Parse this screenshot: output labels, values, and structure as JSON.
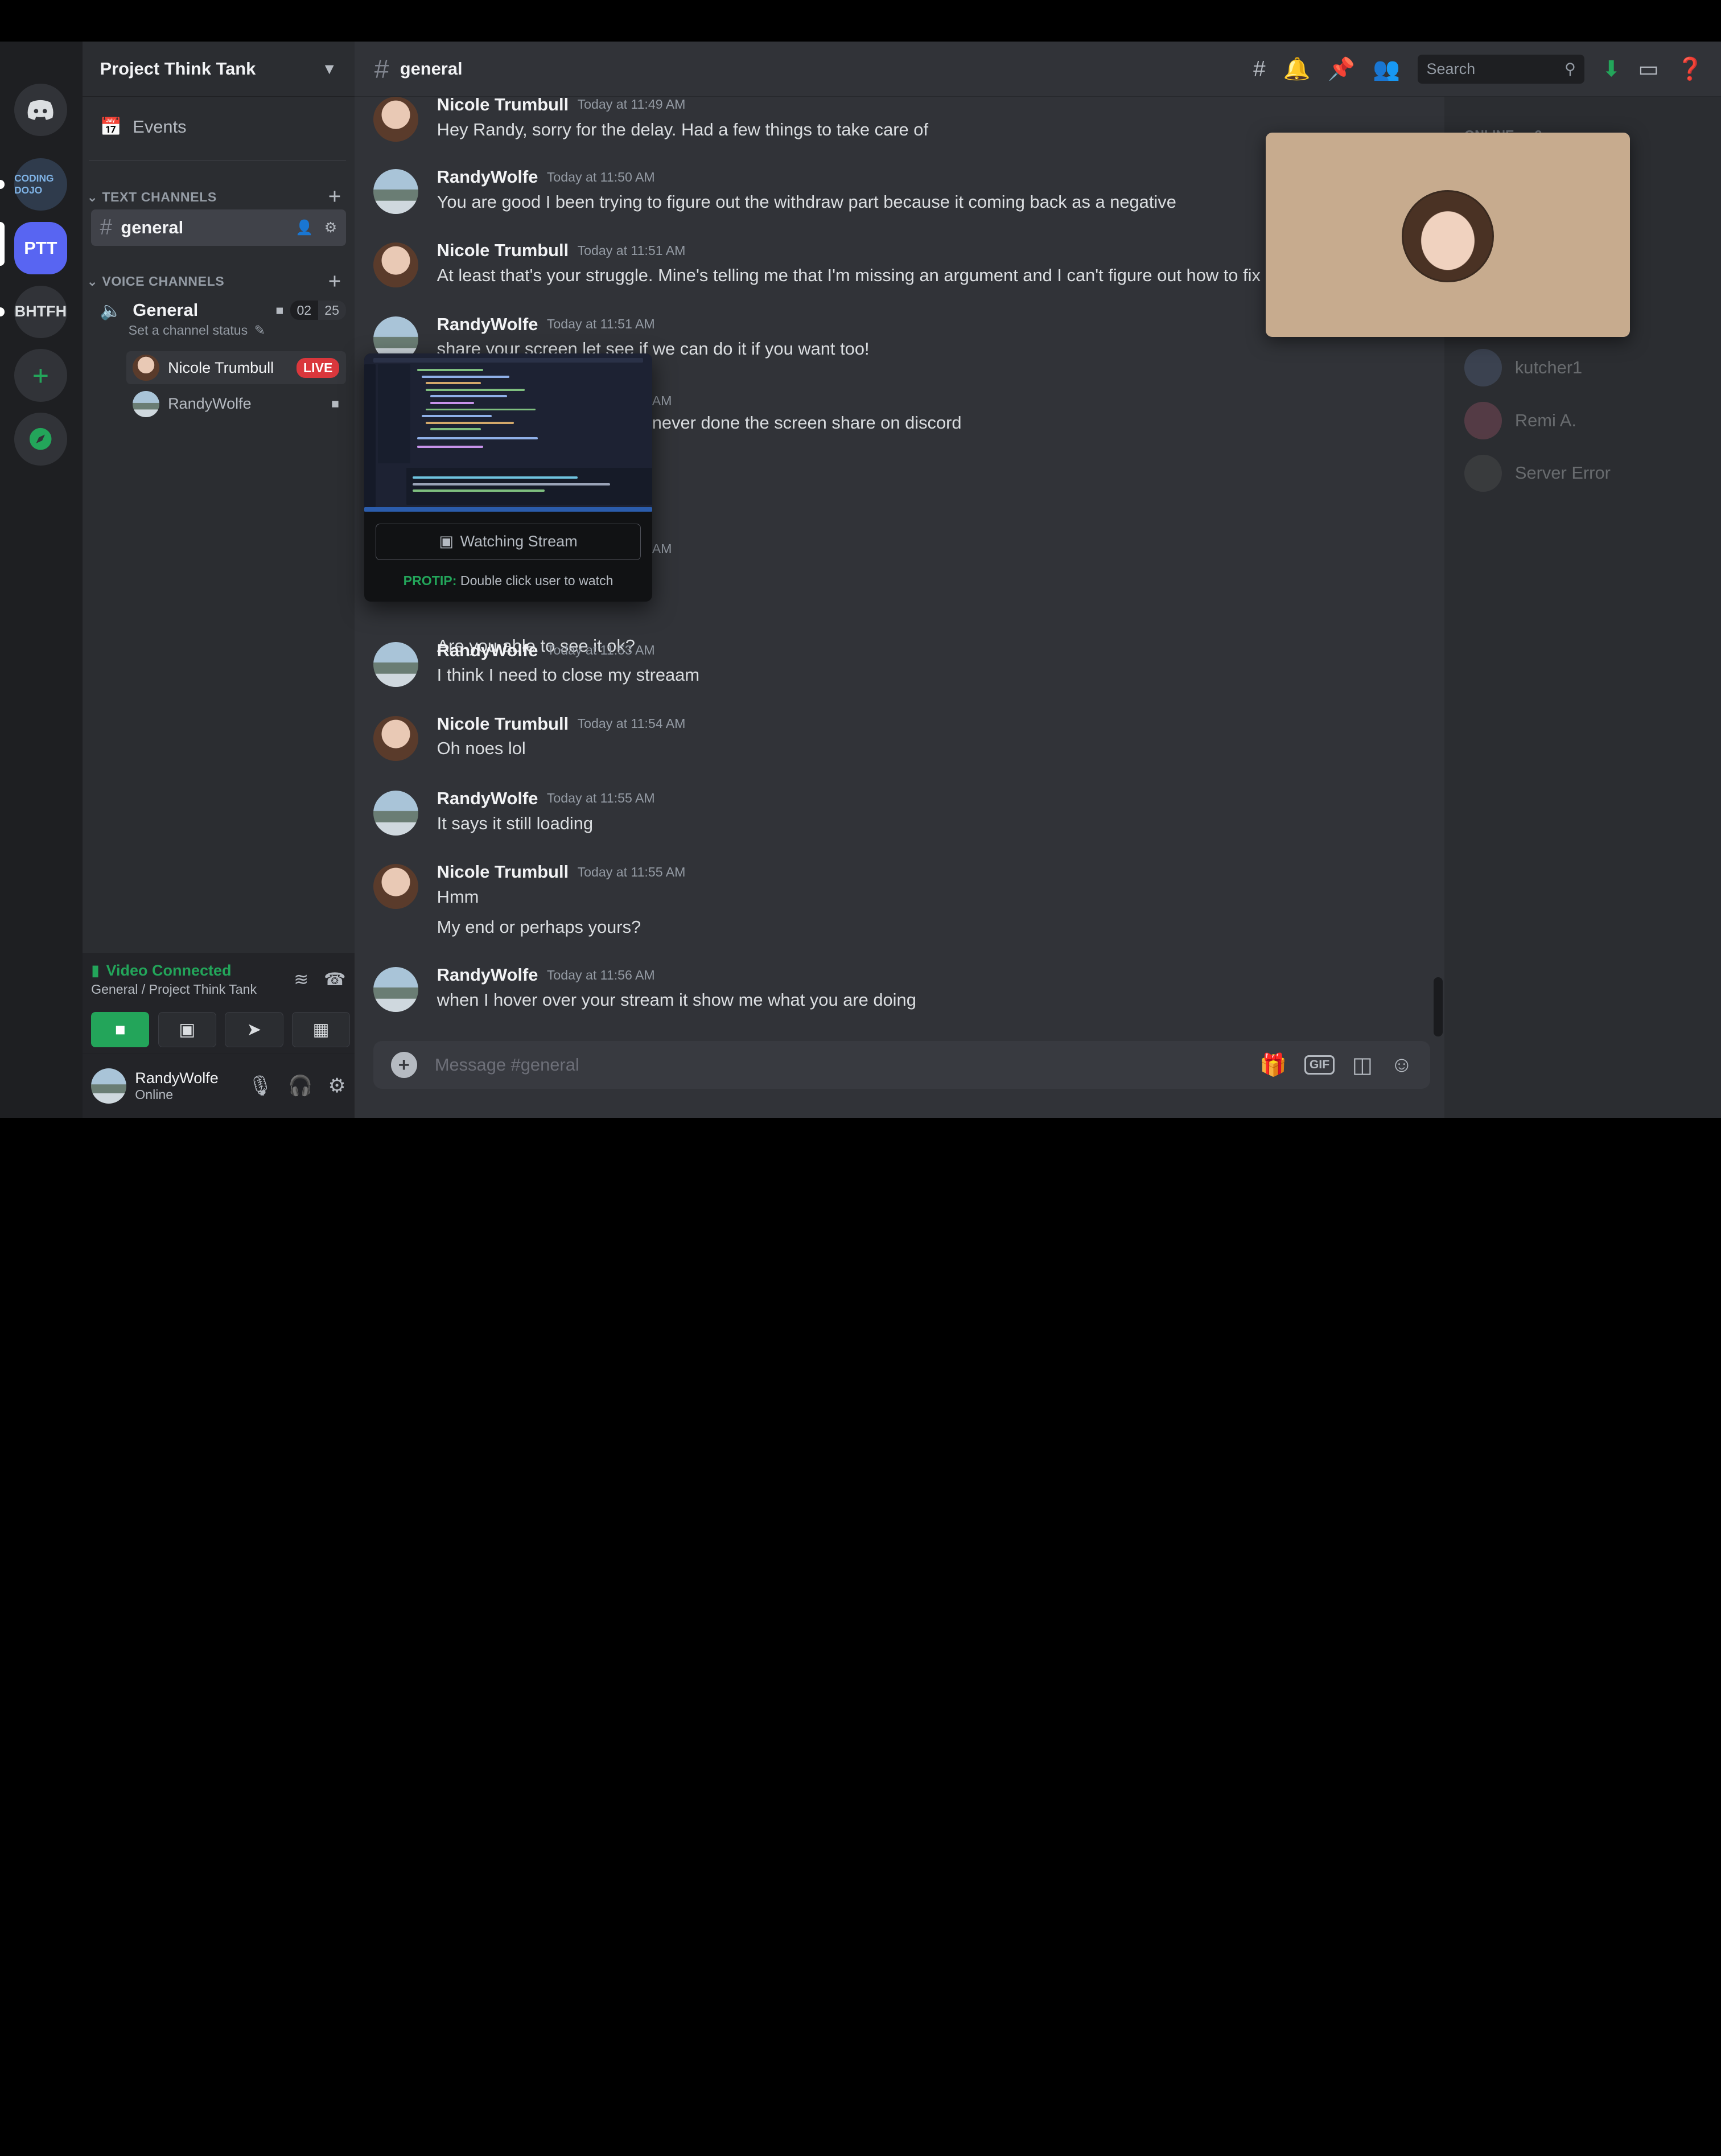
{
  "server": {
    "name": "Project Think Tank",
    "rail": [
      {
        "label": "",
        "icon": "discord-logo-icon"
      },
      {
        "label": "CODING DOJO",
        "icon": "coding-dojo-icon"
      },
      {
        "label": "PTT",
        "icon": "ptt-server-icon"
      },
      {
        "label": "BHTFH",
        "icon": "bhtfh-server-icon"
      },
      {
        "label": "+",
        "icon": "add-server-icon"
      },
      {
        "label": "",
        "icon": "compass-icon"
      }
    ]
  },
  "sidebar": {
    "events": "Events",
    "text_category": "TEXT CHANNELS",
    "text_channel": "general",
    "voice_category": "VOICE CHANNELS",
    "voice_channel": {
      "name": "General",
      "status": "Set a channel status",
      "counter_left": "02",
      "counter_right": "25"
    },
    "voice_users": [
      {
        "name": "Nicole Trumbull",
        "badge": "LIVE"
      },
      {
        "name": "RandyWolfe",
        "badge": ""
      }
    ]
  },
  "voice_panel": {
    "status": "Video Connected",
    "location": "General / Project Think Tank"
  },
  "user_panel": {
    "name": "RandyWolfe",
    "status": "Online"
  },
  "header": {
    "channel": "general",
    "search_placeholder": "Search"
  },
  "messages": [
    {
      "author": "Nicole Trumbull",
      "time": "Today at 11:49 AM",
      "text": "Hey Randy, sorry for the delay. Had a few things to take care of"
    },
    {
      "author": "RandyWolfe",
      "time": "Today at 11:50 AM",
      "text": "You are good I been trying to figure out the withdraw part because it coming back as a negative"
    },
    {
      "author": "Nicole Trumbull",
      "time": "Today at 11:51 AM",
      "text": "At least that's your struggle. Mine's telling me that I'm missing an argument and I can't figure out how to fix it"
    },
    {
      "author": "RandyWolfe",
      "time": "Today at 11:51 AM",
      "text": "share your screen let see if we can do it if you want too!"
    },
    {
      "author": "",
      "time": "AM",
      "text": "never done the screen share on discord"
    },
    {
      "author": "",
      "time": "AM",
      "text": "Are you able to see it ok?"
    },
    {
      "author": "RandyWolfe",
      "time": "Today at 11:53 AM",
      "text": "I think I need to close my streaam"
    },
    {
      "author": "Nicole Trumbull",
      "time": "Today at 11:54 AM",
      "text": "Oh noes lol"
    },
    {
      "author": "RandyWolfe",
      "time": "Today at 11:55 AM",
      "text": "It says it still loading"
    },
    {
      "author": "Nicole Trumbull",
      "time": "Today at 11:55 AM",
      "text": "Hmm",
      "text2": "My end or perhaps yours?"
    },
    {
      "author": "RandyWolfe",
      "time": "Today at 11:56 AM",
      "text": "when I hover over your stream it show me what you are doing"
    }
  ],
  "composer": {
    "placeholder": "Message #general",
    "gif_label": "GIF"
  },
  "members": {
    "header": "ONLINE — 2",
    "list": [
      {
        "name": "kutcher1"
      },
      {
        "name": "Remi A."
      },
      {
        "name": "Server Error"
      }
    ]
  },
  "stream_popup": {
    "button": "Watching Stream",
    "protip_label": "PROTIP:",
    "protip_text": "Double click user to watch"
  },
  "colors": {
    "accent": "#5865f2",
    "green": "#23a55a",
    "live_red": "#da373c"
  }
}
